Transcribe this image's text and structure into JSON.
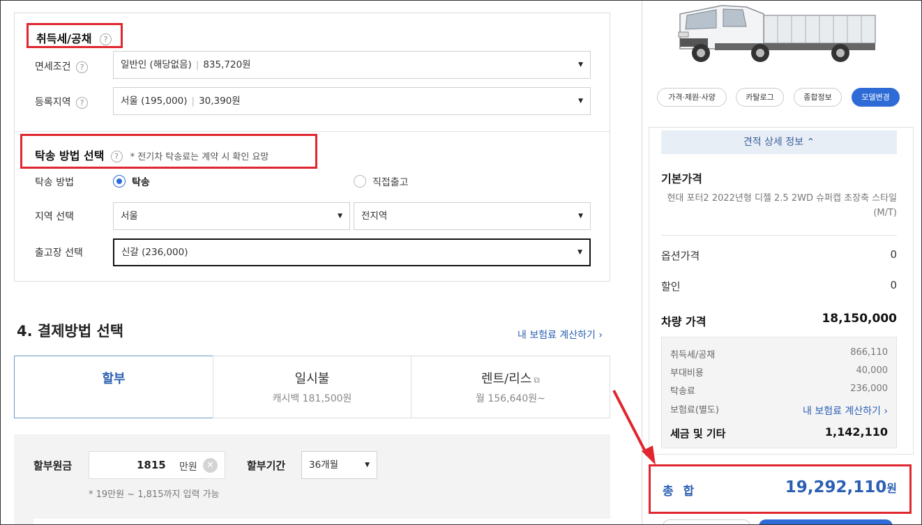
{
  "acquisition": {
    "title": "취득세/공채",
    "help": "?",
    "exemption_label": "면세조건",
    "exemption_value": "일반인 (해당없음)",
    "exemption_amount": "835,720원",
    "region_label": "등록지역",
    "region_value": "서울 (195,000)",
    "region_amount": "30,390원"
  },
  "delivery": {
    "title": "탁송 방법 선택",
    "note": "* 전기차 탁송료는 계약 시 확인 요망",
    "method_label": "탁송 방법",
    "option_delivery": "탁송",
    "option_pickup": "직접출고",
    "area_label": "지역 선택",
    "area_city": "서울",
    "area_district": "전지역",
    "depot_label": "출고장 선택",
    "depot_value": "신갈 (236,000)"
  },
  "payment": {
    "title": "4. 결제방법 선택",
    "insurance_link": "내 보험료 계산하기",
    "tabs": [
      {
        "label": "할부",
        "sub": ""
      },
      {
        "label": "일시불",
        "sub": "캐시백 181,500원"
      },
      {
        "label": "렌트/리스",
        "sub": "월 156,640원~"
      }
    ],
    "principal_label": "할부원금",
    "principal_value": "1815",
    "principal_unit": "만원",
    "period_label": "할부기간",
    "period_value": "36개월",
    "hint": "* 19만원 ~ 1,815까지 입력 가능"
  },
  "sidebar": {
    "pills": [
      "가격·제원·사양",
      "카탈로그",
      "종합정보",
      "모델변경"
    ],
    "estimate_toggle": "견적 상세 정보",
    "base_price_title": "기본가격",
    "model_desc": "현대 포터2 2022년형 디젤 2.5 2WD 슈퍼캡 초장축 스타일 (M/T)",
    "option_label": "옵션가격",
    "option_value": "0",
    "discount_label": "할인",
    "discount_value": "0",
    "vehicle_label": "차량 가격",
    "vehicle_value": "18,150,000",
    "fees": [
      {
        "label": "취득세/공채",
        "value": "866,110"
      },
      {
        "label": "부대비용",
        "value": "40,000"
      },
      {
        "label": "탁송료",
        "value": "236,000"
      },
      {
        "label": "보험료(별도)",
        "value": "내 보험료 계산하기"
      }
    ],
    "tax_total_label": "세금 및 기타",
    "tax_total_value": "1,142,110",
    "grand_label": "총 합",
    "grand_value": "19,292,110",
    "grand_unit": "원"
  },
  "colors": {
    "accent": "#2e6bd6",
    "highlight": "#e0262e"
  }
}
